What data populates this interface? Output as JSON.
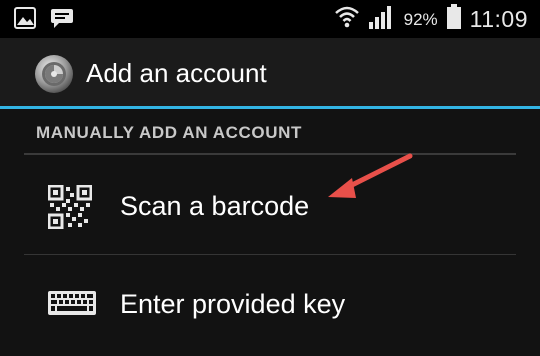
{
  "status_bar": {
    "battery_percent": "92%",
    "time": "11:09",
    "icons": [
      "gallery-icon",
      "chat-icon",
      "wifi-icon",
      "signal-icon",
      "battery-icon"
    ]
  },
  "action_bar": {
    "title": "Add an account",
    "accent_color": "#33b5e5"
  },
  "section": {
    "header": "MANUALLY ADD AN ACCOUNT"
  },
  "items": [
    {
      "label": "Scan a barcode",
      "icon": "qr-code-icon"
    },
    {
      "label": "Enter provided key",
      "icon": "keyboard-icon"
    }
  ],
  "annotation": {
    "arrow_color": "#e8504a"
  }
}
